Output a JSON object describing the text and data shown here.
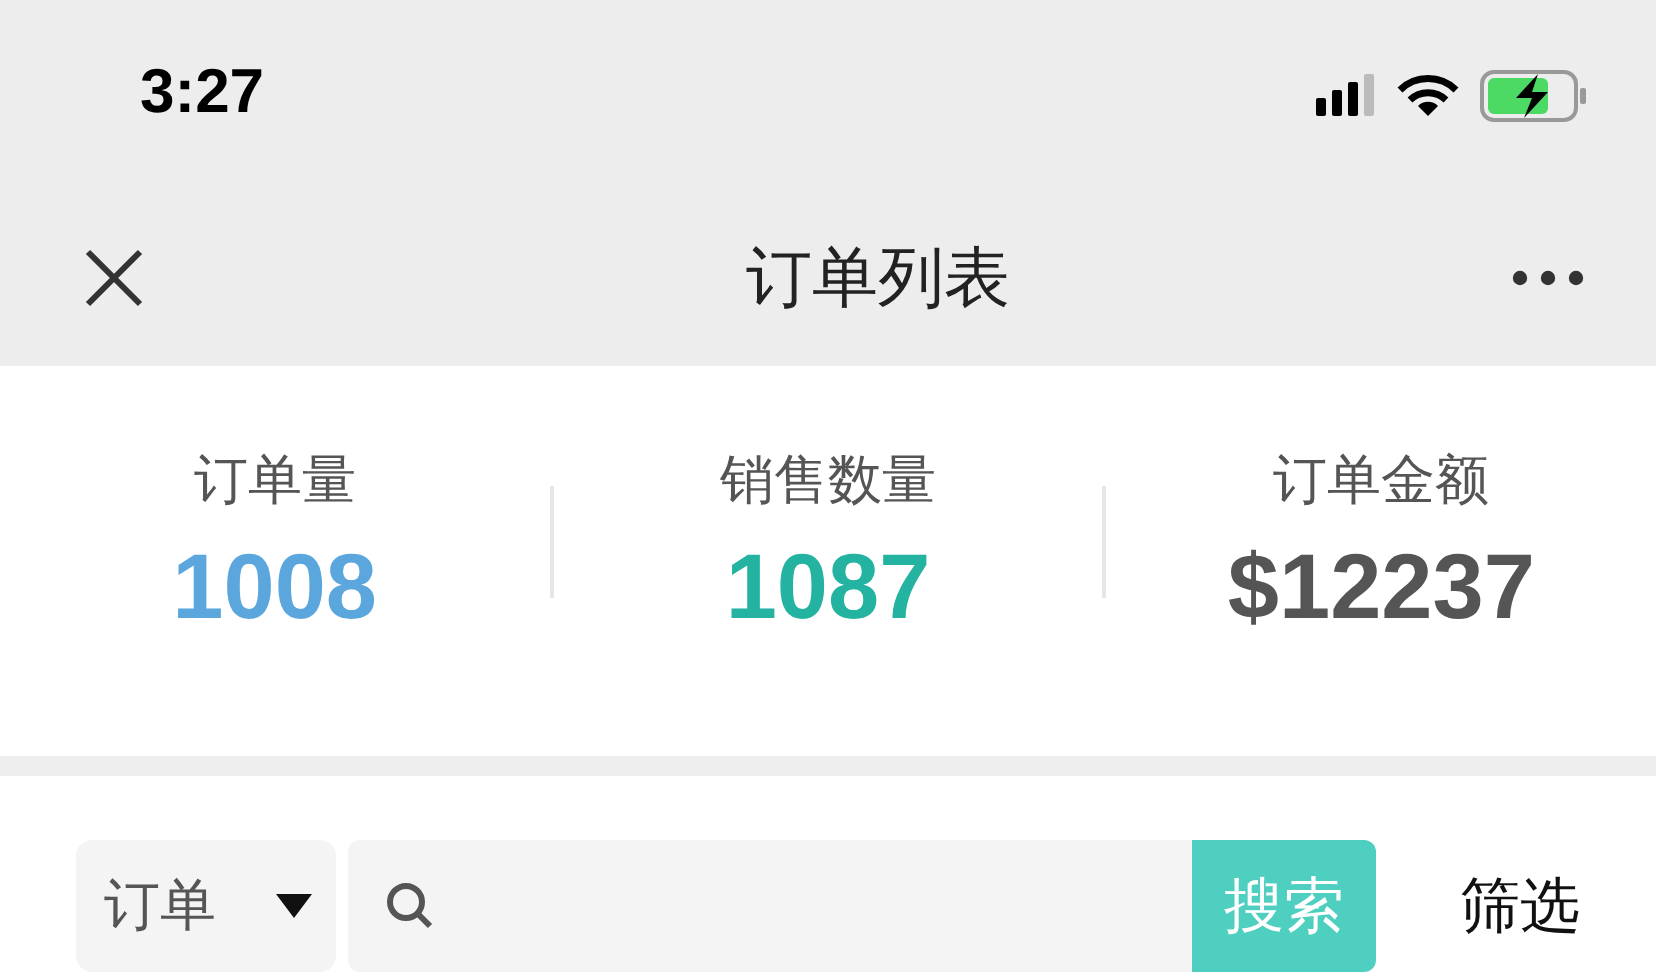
{
  "status_bar": {
    "time": "3:27"
  },
  "nav_bar": {
    "title": "订单列表"
  },
  "stats": [
    {
      "label": "订单量",
      "value": "1008",
      "color": "#5ba7dd"
    },
    {
      "label": "销售数量",
      "value": "1087",
      "color": "#23b3a0"
    },
    {
      "label": "订单金额",
      "value": "$12237",
      "color": "#555555"
    }
  ],
  "search_bar": {
    "select": "订单",
    "button": "搜索",
    "filter": "筛选"
  }
}
